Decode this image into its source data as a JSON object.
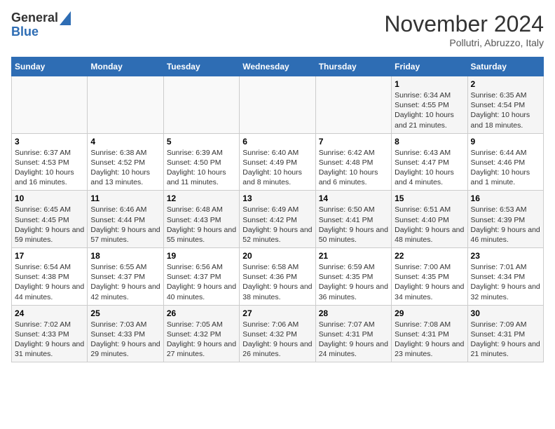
{
  "logo": {
    "general": "General",
    "blue": "Blue"
  },
  "header": {
    "month": "November 2024",
    "location": "Pollutri, Abruzzo, Italy"
  },
  "weekdays": [
    "Sunday",
    "Monday",
    "Tuesday",
    "Wednesday",
    "Thursday",
    "Friday",
    "Saturday"
  ],
  "weeks": [
    [
      {
        "day": "",
        "info": ""
      },
      {
        "day": "",
        "info": ""
      },
      {
        "day": "",
        "info": ""
      },
      {
        "day": "",
        "info": ""
      },
      {
        "day": "",
        "info": ""
      },
      {
        "day": "1",
        "info": "Sunrise: 6:34 AM\nSunset: 4:55 PM\nDaylight: 10 hours and 21 minutes."
      },
      {
        "day": "2",
        "info": "Sunrise: 6:35 AM\nSunset: 4:54 PM\nDaylight: 10 hours and 18 minutes."
      }
    ],
    [
      {
        "day": "3",
        "info": "Sunrise: 6:37 AM\nSunset: 4:53 PM\nDaylight: 10 hours and 16 minutes."
      },
      {
        "day": "4",
        "info": "Sunrise: 6:38 AM\nSunset: 4:52 PM\nDaylight: 10 hours and 13 minutes."
      },
      {
        "day": "5",
        "info": "Sunrise: 6:39 AM\nSunset: 4:50 PM\nDaylight: 10 hours and 11 minutes."
      },
      {
        "day": "6",
        "info": "Sunrise: 6:40 AM\nSunset: 4:49 PM\nDaylight: 10 hours and 8 minutes."
      },
      {
        "day": "7",
        "info": "Sunrise: 6:42 AM\nSunset: 4:48 PM\nDaylight: 10 hours and 6 minutes."
      },
      {
        "day": "8",
        "info": "Sunrise: 6:43 AM\nSunset: 4:47 PM\nDaylight: 10 hours and 4 minutes."
      },
      {
        "day": "9",
        "info": "Sunrise: 6:44 AM\nSunset: 4:46 PM\nDaylight: 10 hours and 1 minute."
      }
    ],
    [
      {
        "day": "10",
        "info": "Sunrise: 6:45 AM\nSunset: 4:45 PM\nDaylight: 9 hours and 59 minutes."
      },
      {
        "day": "11",
        "info": "Sunrise: 6:46 AM\nSunset: 4:44 PM\nDaylight: 9 hours and 57 minutes."
      },
      {
        "day": "12",
        "info": "Sunrise: 6:48 AM\nSunset: 4:43 PM\nDaylight: 9 hours and 55 minutes."
      },
      {
        "day": "13",
        "info": "Sunrise: 6:49 AM\nSunset: 4:42 PM\nDaylight: 9 hours and 52 minutes."
      },
      {
        "day": "14",
        "info": "Sunrise: 6:50 AM\nSunset: 4:41 PM\nDaylight: 9 hours and 50 minutes."
      },
      {
        "day": "15",
        "info": "Sunrise: 6:51 AM\nSunset: 4:40 PM\nDaylight: 9 hours and 48 minutes."
      },
      {
        "day": "16",
        "info": "Sunrise: 6:53 AM\nSunset: 4:39 PM\nDaylight: 9 hours and 46 minutes."
      }
    ],
    [
      {
        "day": "17",
        "info": "Sunrise: 6:54 AM\nSunset: 4:38 PM\nDaylight: 9 hours and 44 minutes."
      },
      {
        "day": "18",
        "info": "Sunrise: 6:55 AM\nSunset: 4:37 PM\nDaylight: 9 hours and 42 minutes."
      },
      {
        "day": "19",
        "info": "Sunrise: 6:56 AM\nSunset: 4:37 PM\nDaylight: 9 hours and 40 minutes."
      },
      {
        "day": "20",
        "info": "Sunrise: 6:58 AM\nSunset: 4:36 PM\nDaylight: 9 hours and 38 minutes."
      },
      {
        "day": "21",
        "info": "Sunrise: 6:59 AM\nSunset: 4:35 PM\nDaylight: 9 hours and 36 minutes."
      },
      {
        "day": "22",
        "info": "Sunrise: 7:00 AM\nSunset: 4:35 PM\nDaylight: 9 hours and 34 minutes."
      },
      {
        "day": "23",
        "info": "Sunrise: 7:01 AM\nSunset: 4:34 PM\nDaylight: 9 hours and 32 minutes."
      }
    ],
    [
      {
        "day": "24",
        "info": "Sunrise: 7:02 AM\nSunset: 4:33 PM\nDaylight: 9 hours and 31 minutes."
      },
      {
        "day": "25",
        "info": "Sunrise: 7:03 AM\nSunset: 4:33 PM\nDaylight: 9 hours and 29 minutes."
      },
      {
        "day": "26",
        "info": "Sunrise: 7:05 AM\nSunset: 4:32 PM\nDaylight: 9 hours and 27 minutes."
      },
      {
        "day": "27",
        "info": "Sunrise: 7:06 AM\nSunset: 4:32 PM\nDaylight: 9 hours and 26 minutes."
      },
      {
        "day": "28",
        "info": "Sunrise: 7:07 AM\nSunset: 4:31 PM\nDaylight: 9 hours and 24 minutes."
      },
      {
        "day": "29",
        "info": "Sunrise: 7:08 AM\nSunset: 4:31 PM\nDaylight: 9 hours and 23 minutes."
      },
      {
        "day": "30",
        "info": "Sunrise: 7:09 AM\nSunset: 4:31 PM\nDaylight: 9 hours and 21 minutes."
      }
    ]
  ]
}
